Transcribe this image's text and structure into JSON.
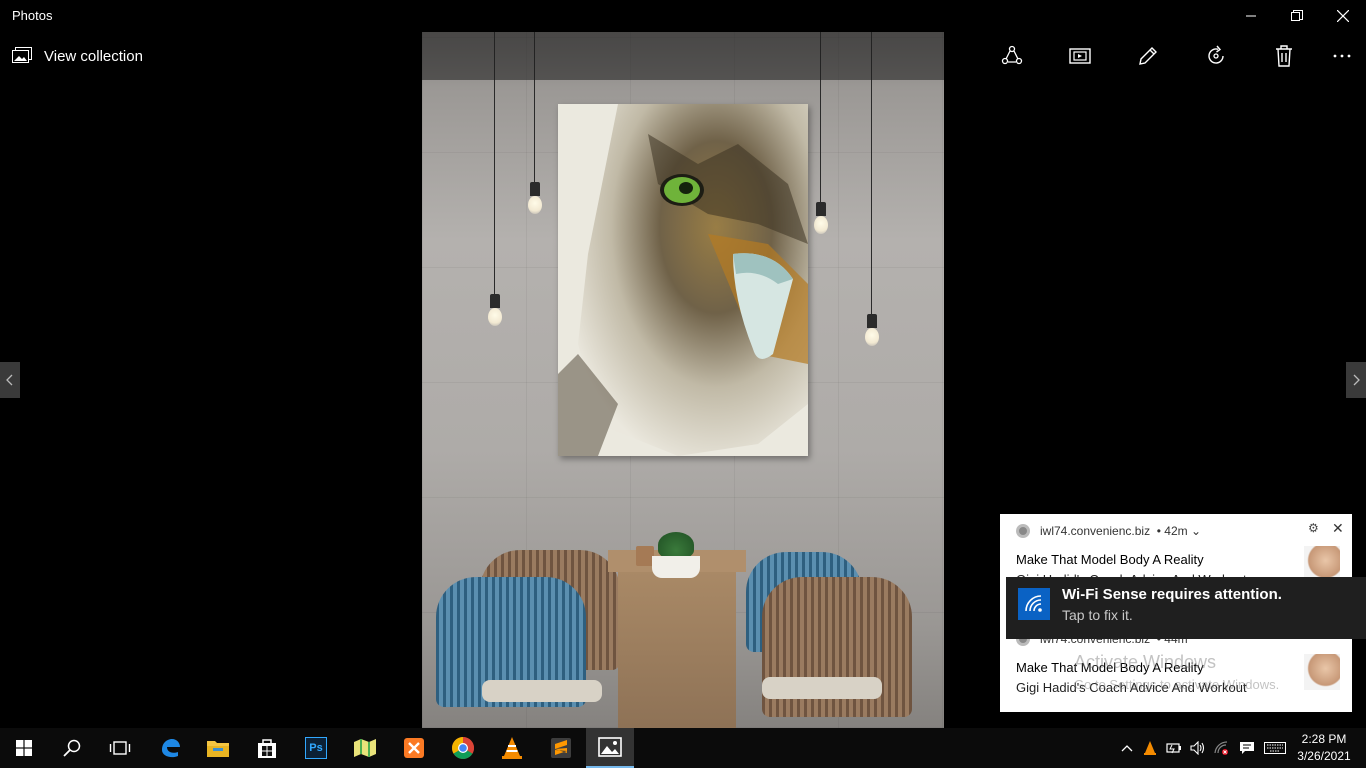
{
  "window": {
    "title": "Photos",
    "controls": [
      "minimize-icon",
      "restore-icon",
      "close-icon"
    ]
  },
  "toolbar": {
    "view_collection_label": "View collection",
    "buttons": [
      "share-icon",
      "slideshow-icon",
      "edit-pencil-icon",
      "rotate-icon",
      "delete-icon",
      "more-icon"
    ]
  },
  "photo": {
    "subject": "painting-of-eagle-on-concrete-wall-above-table",
    "icon_names": [
      "previous-arrow-icon",
      "next-arrow-icon"
    ]
  },
  "notifications": [
    {
      "source": "iwl74.convenienc.biz",
      "age": "42m",
      "title": "Make That Model Body A Reality",
      "body": "Gigi Hadid's Coach Advice And Workout"
    },
    {
      "source": "iwl74.convenienc.biz",
      "age": "44m",
      "title": "Make That Model Body A Reality",
      "body": "Gigi Hadid's Coach Advice And Workout"
    }
  ],
  "toast": {
    "title": "Wi-Fi Sense requires attention.",
    "subtitle": "Tap to fix it."
  },
  "watermark": {
    "line1": "Activate Windows",
    "line2": "Go to Settings to activate Windows."
  },
  "taskbar": {
    "apps": [
      "start-icon",
      "search-icon",
      "task-view-icon",
      "edge-icon",
      "file-explorer-icon",
      "store-icon",
      "photoshop-icon",
      "maps-icon",
      "xampp-icon",
      "chrome-icon",
      "vlc-icon",
      "sublime-icon",
      "photos-icon"
    ],
    "photoshop_label": "Ps",
    "tray": [
      "chevron-up-icon",
      "vlc-tray-icon",
      "battery-icon",
      "volume-icon",
      "network-icon",
      "notification-icon",
      "keyboard-icon"
    ],
    "time": "2:28 PM",
    "date": "3/26/2021"
  },
  "colors": {
    "accent": "#76b9ed",
    "toast_icon": "#0a62c4",
    "taskbar": "#0b0b0b"
  }
}
